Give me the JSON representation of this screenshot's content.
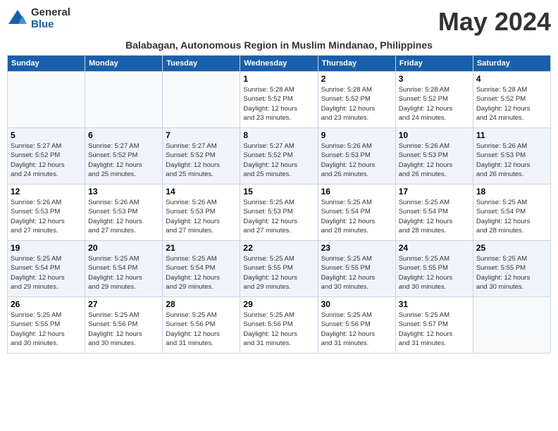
{
  "logo": {
    "general": "General",
    "blue": "Blue"
  },
  "title": "May 2024",
  "subtitle": "Balabagan, Autonomous Region in Muslim Mindanao, Philippines",
  "headers": [
    "Sunday",
    "Monday",
    "Tuesday",
    "Wednesday",
    "Thursday",
    "Friday",
    "Saturday"
  ],
  "weeks": [
    [
      {
        "day": "",
        "info": ""
      },
      {
        "day": "",
        "info": ""
      },
      {
        "day": "",
        "info": ""
      },
      {
        "day": "1",
        "info": "Sunrise: 5:28 AM\nSunset: 5:52 PM\nDaylight: 12 hours\nand 23 minutes."
      },
      {
        "day": "2",
        "info": "Sunrise: 5:28 AM\nSunset: 5:52 PM\nDaylight: 12 hours\nand 23 minutes."
      },
      {
        "day": "3",
        "info": "Sunrise: 5:28 AM\nSunset: 5:52 PM\nDaylight: 12 hours\nand 24 minutes."
      },
      {
        "day": "4",
        "info": "Sunrise: 5:28 AM\nSunset: 5:52 PM\nDaylight: 12 hours\nand 24 minutes."
      }
    ],
    [
      {
        "day": "5",
        "info": "Sunrise: 5:27 AM\nSunset: 5:52 PM\nDaylight: 12 hours\nand 24 minutes."
      },
      {
        "day": "6",
        "info": "Sunrise: 5:27 AM\nSunset: 5:52 PM\nDaylight: 12 hours\nand 25 minutes."
      },
      {
        "day": "7",
        "info": "Sunrise: 5:27 AM\nSunset: 5:52 PM\nDaylight: 12 hours\nand 25 minutes."
      },
      {
        "day": "8",
        "info": "Sunrise: 5:27 AM\nSunset: 5:52 PM\nDaylight: 12 hours\nand 25 minutes."
      },
      {
        "day": "9",
        "info": "Sunrise: 5:26 AM\nSunset: 5:53 PM\nDaylight: 12 hours\nand 26 minutes."
      },
      {
        "day": "10",
        "info": "Sunrise: 5:26 AM\nSunset: 5:53 PM\nDaylight: 12 hours\nand 26 minutes."
      },
      {
        "day": "11",
        "info": "Sunrise: 5:26 AM\nSunset: 5:53 PM\nDaylight: 12 hours\nand 26 minutes."
      }
    ],
    [
      {
        "day": "12",
        "info": "Sunrise: 5:26 AM\nSunset: 5:53 PM\nDaylight: 12 hours\nand 27 minutes."
      },
      {
        "day": "13",
        "info": "Sunrise: 5:26 AM\nSunset: 5:53 PM\nDaylight: 12 hours\nand 27 minutes."
      },
      {
        "day": "14",
        "info": "Sunrise: 5:26 AM\nSunset: 5:53 PM\nDaylight: 12 hours\nand 27 minutes."
      },
      {
        "day": "15",
        "info": "Sunrise: 5:25 AM\nSunset: 5:53 PM\nDaylight: 12 hours\nand 27 minutes."
      },
      {
        "day": "16",
        "info": "Sunrise: 5:25 AM\nSunset: 5:54 PM\nDaylight: 12 hours\nand 28 minutes."
      },
      {
        "day": "17",
        "info": "Sunrise: 5:25 AM\nSunset: 5:54 PM\nDaylight: 12 hours\nand 28 minutes."
      },
      {
        "day": "18",
        "info": "Sunrise: 5:25 AM\nSunset: 5:54 PM\nDaylight: 12 hours\nand 28 minutes."
      }
    ],
    [
      {
        "day": "19",
        "info": "Sunrise: 5:25 AM\nSunset: 5:54 PM\nDaylight: 12 hours\nand 29 minutes."
      },
      {
        "day": "20",
        "info": "Sunrise: 5:25 AM\nSunset: 5:54 PM\nDaylight: 12 hours\nand 29 minutes."
      },
      {
        "day": "21",
        "info": "Sunrise: 5:25 AM\nSunset: 5:54 PM\nDaylight: 12 hours\nand 29 minutes."
      },
      {
        "day": "22",
        "info": "Sunrise: 5:25 AM\nSunset: 5:55 PM\nDaylight: 12 hours\nand 29 minutes."
      },
      {
        "day": "23",
        "info": "Sunrise: 5:25 AM\nSunset: 5:55 PM\nDaylight: 12 hours\nand 30 minutes."
      },
      {
        "day": "24",
        "info": "Sunrise: 5:25 AM\nSunset: 5:55 PM\nDaylight: 12 hours\nand 30 minutes."
      },
      {
        "day": "25",
        "info": "Sunrise: 5:25 AM\nSunset: 5:55 PM\nDaylight: 12 hours\nand 30 minutes."
      }
    ],
    [
      {
        "day": "26",
        "info": "Sunrise: 5:25 AM\nSunset: 5:55 PM\nDaylight: 12 hours\nand 30 minutes."
      },
      {
        "day": "27",
        "info": "Sunrise: 5:25 AM\nSunset: 5:56 PM\nDaylight: 12 hours\nand 30 minutes."
      },
      {
        "day": "28",
        "info": "Sunrise: 5:25 AM\nSunset: 5:56 PM\nDaylight: 12 hours\nand 31 minutes."
      },
      {
        "day": "29",
        "info": "Sunrise: 5:25 AM\nSunset: 5:56 PM\nDaylight: 12 hours\nand 31 minutes."
      },
      {
        "day": "30",
        "info": "Sunrise: 5:25 AM\nSunset: 5:56 PM\nDaylight: 12 hours\nand 31 minutes."
      },
      {
        "day": "31",
        "info": "Sunrise: 5:25 AM\nSunset: 5:57 PM\nDaylight: 12 hours\nand 31 minutes."
      },
      {
        "day": "",
        "info": ""
      }
    ]
  ]
}
